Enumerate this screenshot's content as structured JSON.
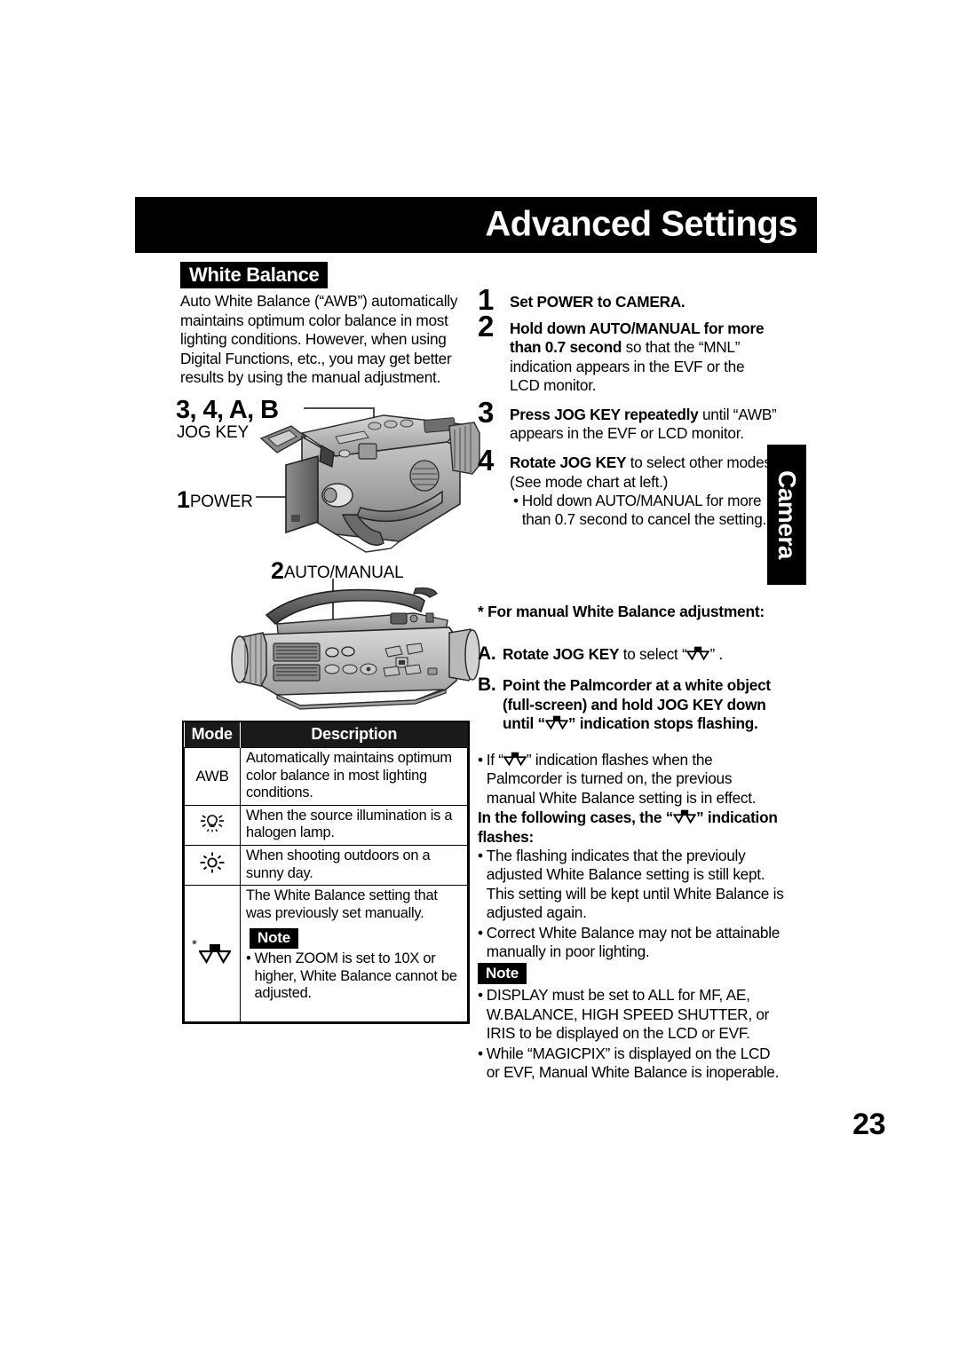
{
  "header": {
    "title": "Advanced Settings"
  },
  "section": {
    "chip_label": "White Balance",
    "intro": "Auto White Balance (“AWB”) automatically maintains optimum color balance in most lighting conditions. However, when using Digital Functions, etc., you may get better results by using the manual adjustment."
  },
  "diagram": {
    "callout_jog_numbers": "3, 4, A, B",
    "callout_jog_label": "JOG KEY",
    "callout_power_num": "1",
    "callout_power_label": "POWER",
    "callout_automanual_num": "2",
    "callout_automanual_label": "AUTO/MANUAL"
  },
  "mode_table": {
    "columns": [
      "Mode",
      "Description"
    ],
    "rows": [
      {
        "mode": "AWB",
        "mode_icon": "text-awb",
        "description": "Automatically maintains optimum color balance in most lighting conditions."
      },
      {
        "mode": "",
        "mode_icon": "halogen-lamp-icon",
        "description": "When the source illumination is a halogen lamp."
      },
      {
        "mode": "",
        "mode_icon": "sun-icon",
        "description": "When shooting outdoors on a sunny day."
      },
      {
        "mode": "*",
        "mode_icon": "manual-white-balance-icon",
        "description": "The White Balance setting that was previously set manually.",
        "note_chip": "Note",
        "note_bullet_dot": "•",
        "note_text": "When ZOOM is set to 10X or higher, White Balance cannot be adjusted."
      }
    ]
  },
  "steps": [
    {
      "num": "1",
      "bold1": "Set POWER to CAMERA.",
      "rest": ""
    },
    {
      "num": "2",
      "bold1": "Hold down AUTO/MANUAL for more than 0.7 second",
      "rest": " so that the “MNL” indication appears in the EVF or the LCD monitor."
    },
    {
      "num": "3",
      "bold1": "Press JOG KEY repeatedly",
      "rest": " until “AWB” appears in the EVF or LCD monitor."
    },
    {
      "num": "4",
      "bold1": "Rotate JOG KEY",
      "rest": " to select other modes. (See mode chart at left.)",
      "bullet_dot": "•",
      "bullet_text": "Hold down AUTO/MANUAL for more than 0.7 second to cancel the setting."
    }
  ],
  "manual_section": {
    "heading": "* For manual White Balance adjustment:",
    "items": [
      {
        "letter": "A.",
        "bold_pre": "Rotate JOG KEY",
        "post_before_icon": " to select “",
        "icon": "manual-white-balance-icon",
        "post_after_icon": "” ."
      },
      {
        "letter": "B.",
        "bold_pre": "Point the Palmcorder at a white object (full-screen) and hold JOG KEY down until “",
        "icon": "manual-white-balance-icon",
        "bold_post": "” indication stops flashing."
      }
    ]
  },
  "flash_notes": {
    "bullet1_dot": "•",
    "bullet1_pre": "If “",
    "bullet1_icon": "manual-white-balance-icon",
    "bullet1_post": "” indication flashes when the Palmcorder is turned on, the previous manual White Balance setting is in effect.",
    "bold_head_pre": "In the following cases, the “",
    "bold_head_icon": "manual-white-balance-icon",
    "bold_head_post": "” indication flashes:",
    "bullet2_dot": "•",
    "bullet2_text": "The flashing indicates that the previouly adjusted White Balance setting is still kept. This setting will be kept until White Balance is adjusted again.",
    "bullet3_dot": "•",
    "bullet3_text": "Correct White Balance may not be attainable manually in poor lighting."
  },
  "note_block": {
    "chip_label": "Note",
    "bullet1_dot": "•",
    "bullet1_text": "DISPLAY must be set to ALL for MF, AE, W.BALANCE, HIGH SPEED SHUTTER, or IRIS to be displayed on the LCD or EVF.",
    "bullet2_dot": "•",
    "bullet2_text": "While “MAGICPIX” is displayed on the LCD or EVF, Manual White Balance is inoperable."
  },
  "side_tab": {
    "label": "Camera"
  },
  "page_number": "23",
  "colors": {
    "ink": "#000000",
    "paper": "#ffffff",
    "leader_line": "#4a4a4a"
  }
}
